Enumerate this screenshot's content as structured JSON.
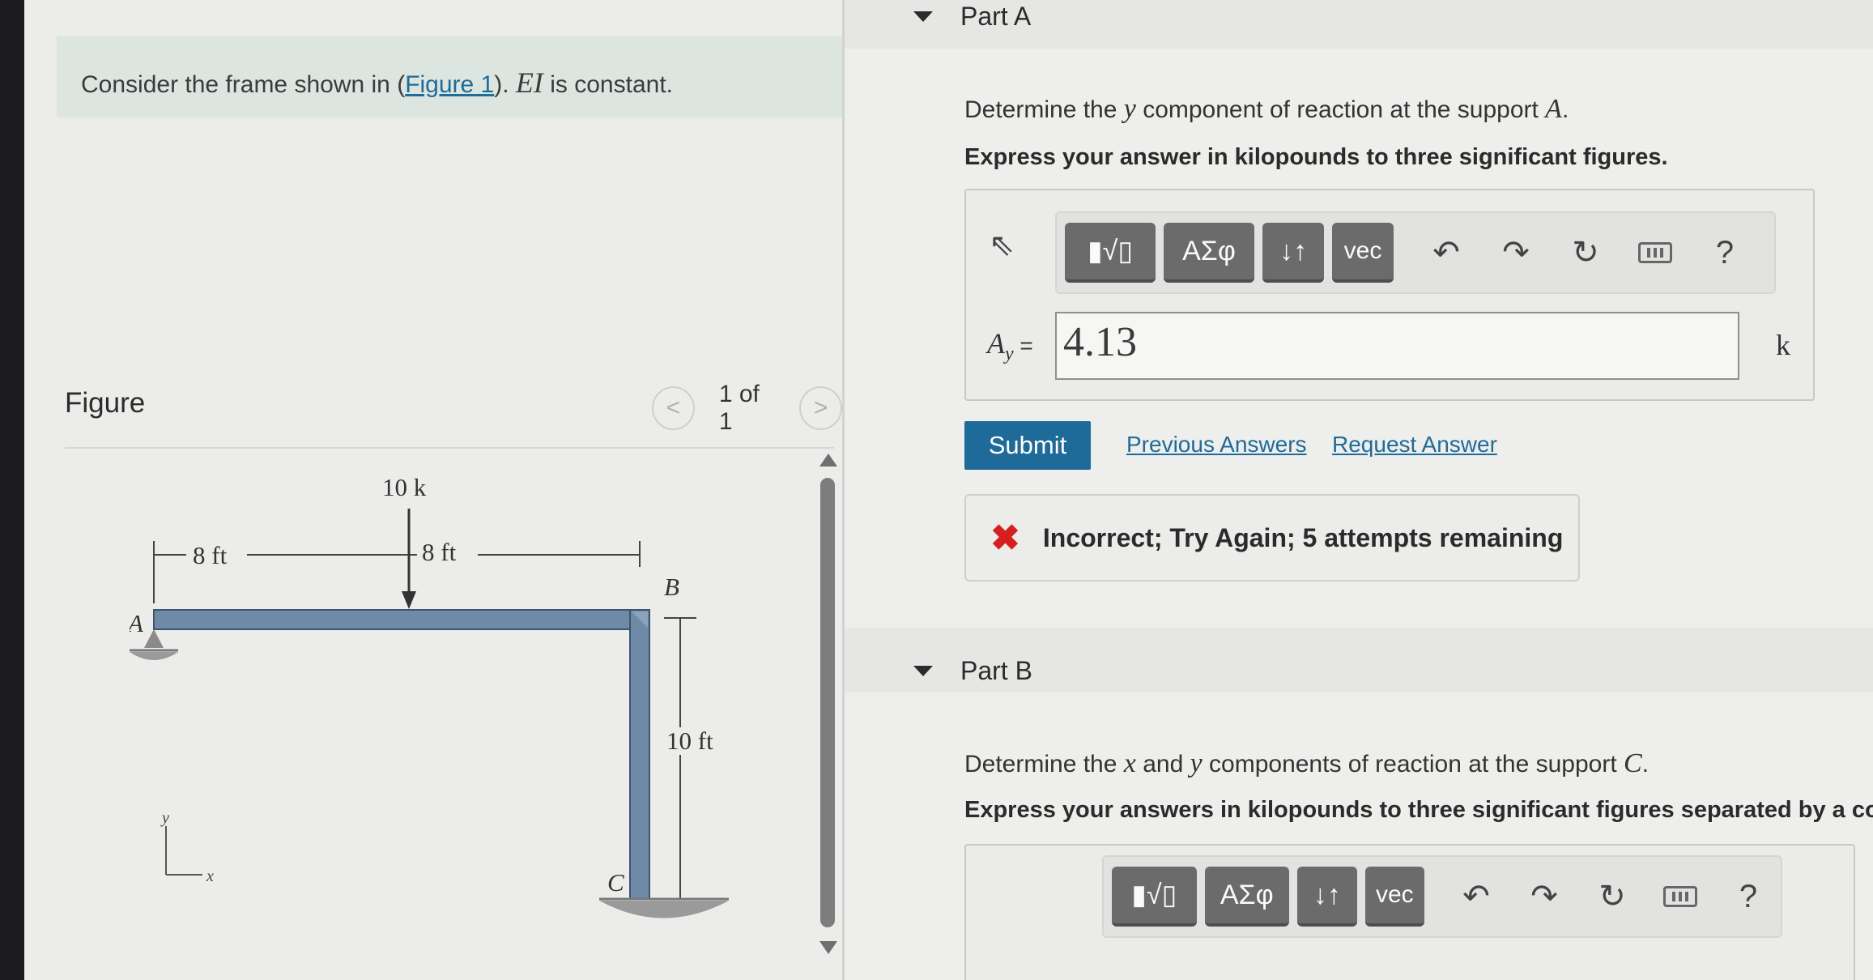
{
  "problem": {
    "text_prefix": "Consider the frame shown in (",
    "figure_link": "Figure 1",
    "text_middle": ").",
    "ei": "EI",
    "text_suffix": " is constant."
  },
  "figure": {
    "title": "Figure",
    "pager_prev": "<",
    "pager_text": "1 of 1",
    "pager_next": ">",
    "labels": {
      "load": "10 k",
      "span_left": "8 ft",
      "span_right": "8 ft",
      "height": "10 ft",
      "point_a": "A",
      "point_b": "B",
      "point_c": "C",
      "axis_y": "y",
      "axis_x": "x"
    }
  },
  "part_a": {
    "title": "Part A",
    "question_prefix": "Determine the ",
    "question_var": "y",
    "question_mid": " component of reaction at the support ",
    "question_support": "A",
    "question_suffix": ".",
    "instruction": "Express your answer in kilopounds to three significant figures.",
    "toolbar": [
      "▮√▯",
      "ΑΣφ",
      "↓↑",
      "vec"
    ],
    "answer_label": "A",
    "answer_sub": "y",
    "answer_eq": " =",
    "answer_value": "4.13",
    "unit": "k",
    "help": "?",
    "submit": "Submit",
    "previous_answers": "Previous Answers",
    "request_answer": "Request Answer",
    "feedback": "Incorrect; Try Again; 5 attempts remaining"
  },
  "part_b": {
    "title": "Part B",
    "question_prefix": "Determine the ",
    "question_x": "x",
    "question_and": " and ",
    "question_y": "y",
    "question_mid": " components of reaction at the support ",
    "question_support": "C",
    "question_suffix": ".",
    "instruction": "Express your answers in kilopounds to three significant figures separated by a co",
    "toolbar": [
      "▮√▯",
      "ΑΣφ",
      "↓↑",
      "vec"
    ],
    "help": "?"
  },
  "colors": {
    "accent": "#1e6a99",
    "error": "#d62020",
    "frame": "#6f8aa6"
  }
}
